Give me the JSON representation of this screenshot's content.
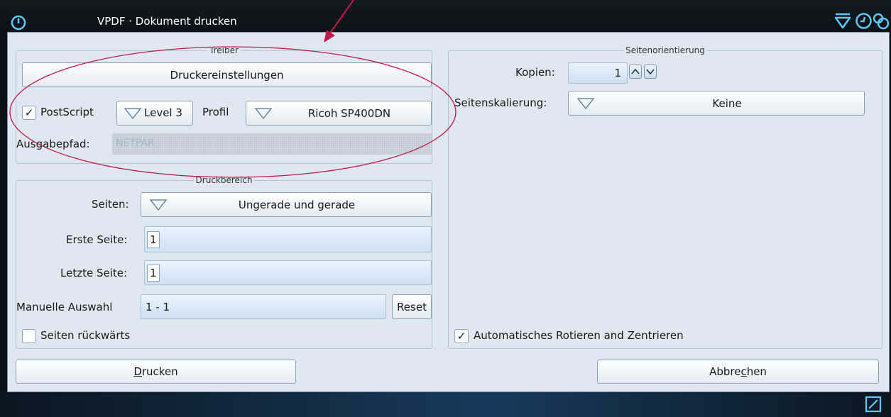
{
  "titlebar": {
    "title": "VPDF · Dokument drucken",
    "app_icon": "power-icon",
    "right_icons": [
      "menu-triangle-icon",
      "clock-icon",
      "spiral-icon"
    ]
  },
  "treiber": {
    "title": "Treiber",
    "settings_button": "Druckereinstellungen",
    "postscript_label": "PostScript",
    "postscript_checked": true,
    "level_value": "Level 3",
    "profil_label": "Profil",
    "profil_value": "Ricoh SP400DN",
    "ausgabepfad_label": "Ausgabepfad:",
    "ausgabepfad_value": "NETPAR"
  },
  "druckbereich": {
    "title": "Druckbereich",
    "seiten_label": "Seiten:",
    "seiten_value": "Ungerade und gerade",
    "erste_label": "Erste Seite:",
    "erste_value": "1",
    "letzte_label": "Letzte Seite:",
    "letzte_value": "1",
    "manuell_label": "Manuelle Auswahl",
    "manuell_value": "1 - 1",
    "reset_label": "Reset",
    "rueckwaerts_label": "Seiten rückwärts",
    "rueckwaerts_checked": false
  },
  "orientierung": {
    "title": "Seitenorientierung",
    "kopien_label": "Kopien:",
    "kopien_value": "1",
    "skalierung_label": "Seitenskalierung:",
    "skalierung_value": "Keine",
    "auto_label": "Automatisches Rotieren and Zentrieren",
    "auto_checked": true
  },
  "actions": {
    "print_accel": "D",
    "print_rest": "rucken",
    "cancel_pre": "Abbre",
    "cancel_accel": "c",
    "cancel_post": "hen"
  },
  "colors": {
    "accent": "#5bc8f5",
    "annotation": "#c4184a",
    "window_bg": "#dfe8f1"
  },
  "checkmark": "✓"
}
